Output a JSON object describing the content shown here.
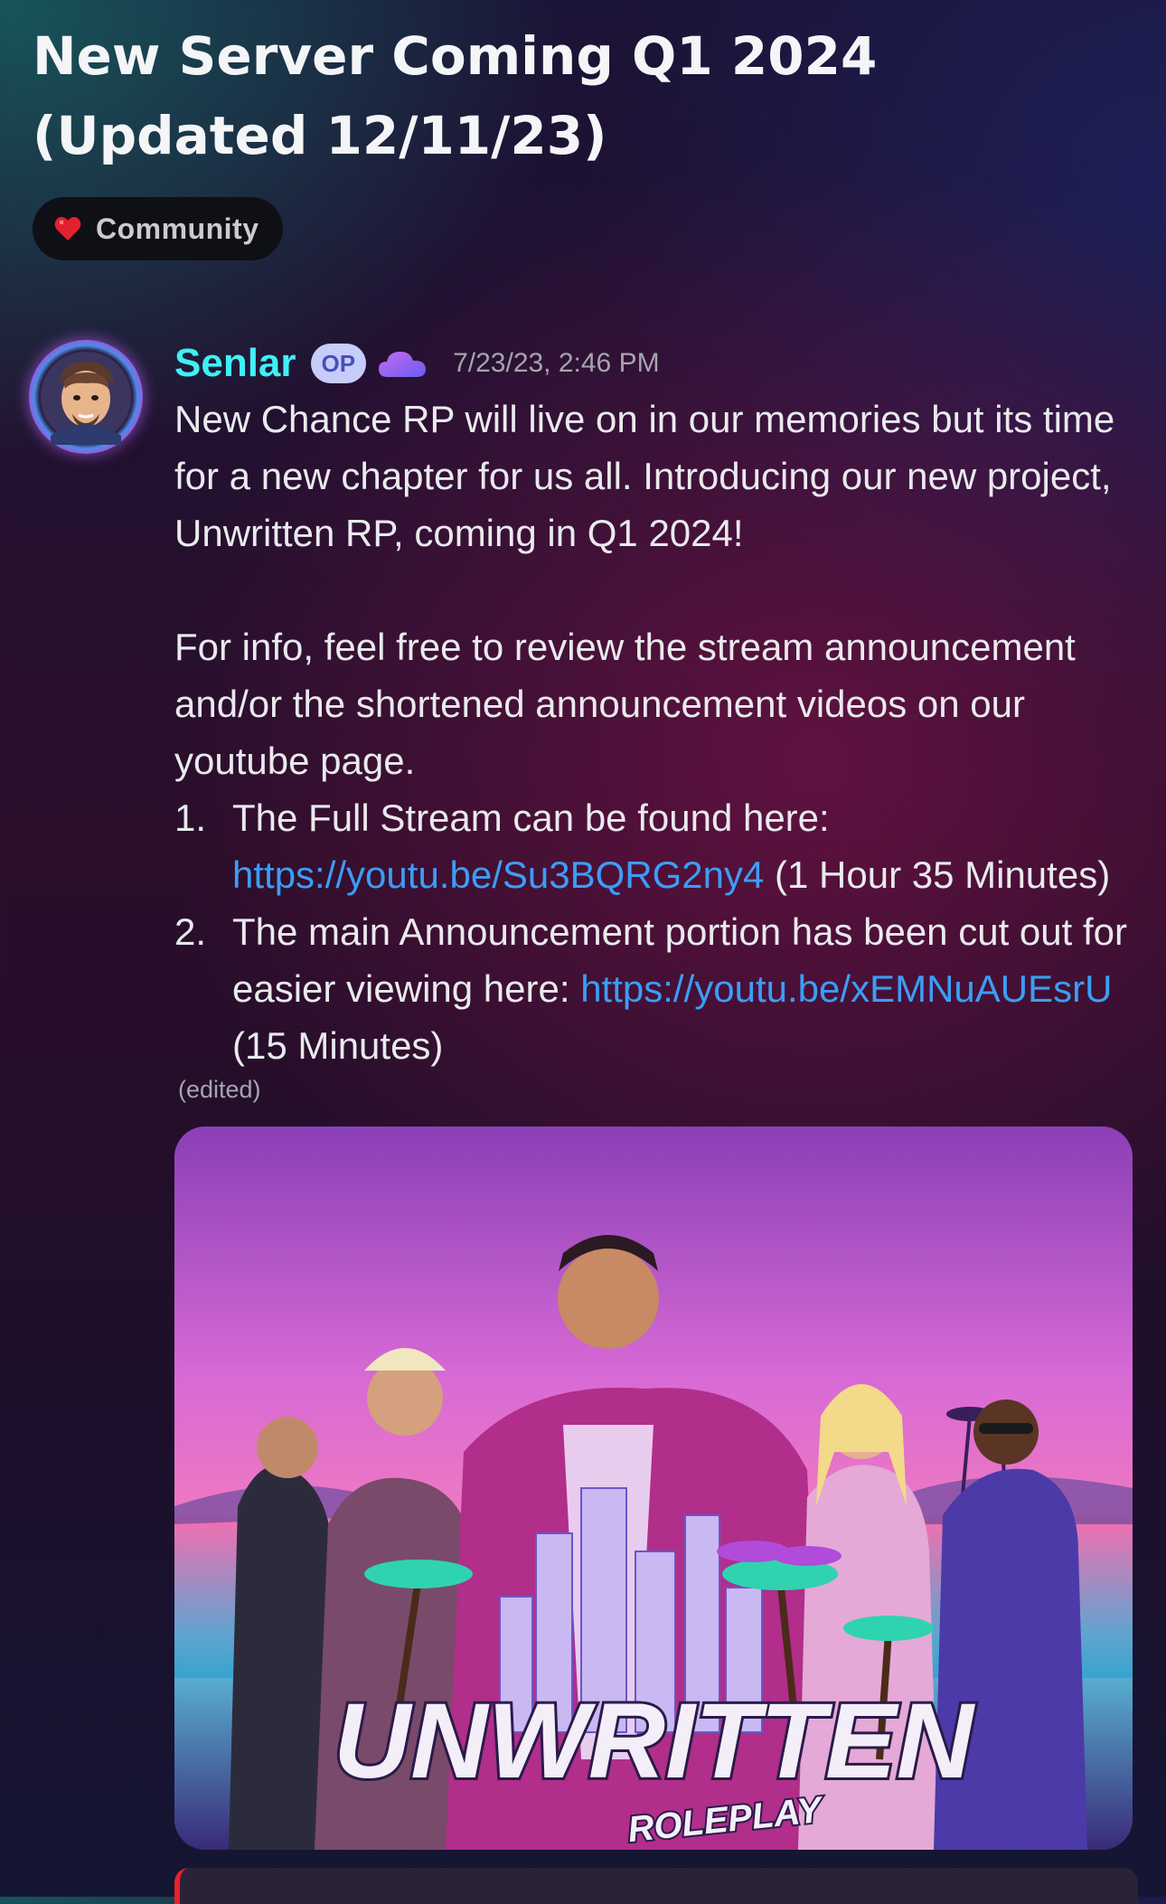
{
  "thread": {
    "title_line1": "New Server Coming Q1 2024",
    "title_line2": "(Updated 12/11/23)",
    "tag": {
      "icon": "heart-icon",
      "label": "Community"
    }
  },
  "message": {
    "author": "Senlar",
    "badge": "OP",
    "badge_icon": "cloud-icon",
    "timestamp": "7/23/23, 2:46 PM",
    "para1": "New Chance RP will live on in our memories but its time for a new chapter for us all. Introducing our new project, Unwritten RP, coming in Q1 2024!",
    "para2": "For info, feel free to review the stream announcement and/or the shortened announcement videos on our youtube page.",
    "items": [
      {
        "num": "1.",
        "text": "The Full Stream can be found here: ",
        "link": "https://youtu.be/Su3BQRG2ny4",
        "suffix": " (1 Hour 35 Minutes)"
      },
      {
        "num": "2.",
        "text": "The main Announcement portion has been cut out for easier viewing here: ",
        "link": "https://youtu.be/xEMNuAUEsrU",
        "suffix": " (15 Minutes)"
      }
    ],
    "edited": "(edited)"
  },
  "attachment": {
    "logo_text": "UNWRITTEN",
    "logo_subtext": "ROLEPLAY"
  },
  "colors": {
    "author": "#3ff0f6",
    "link": "#3c9df5",
    "badge_bg": "#c7cdfa"
  }
}
